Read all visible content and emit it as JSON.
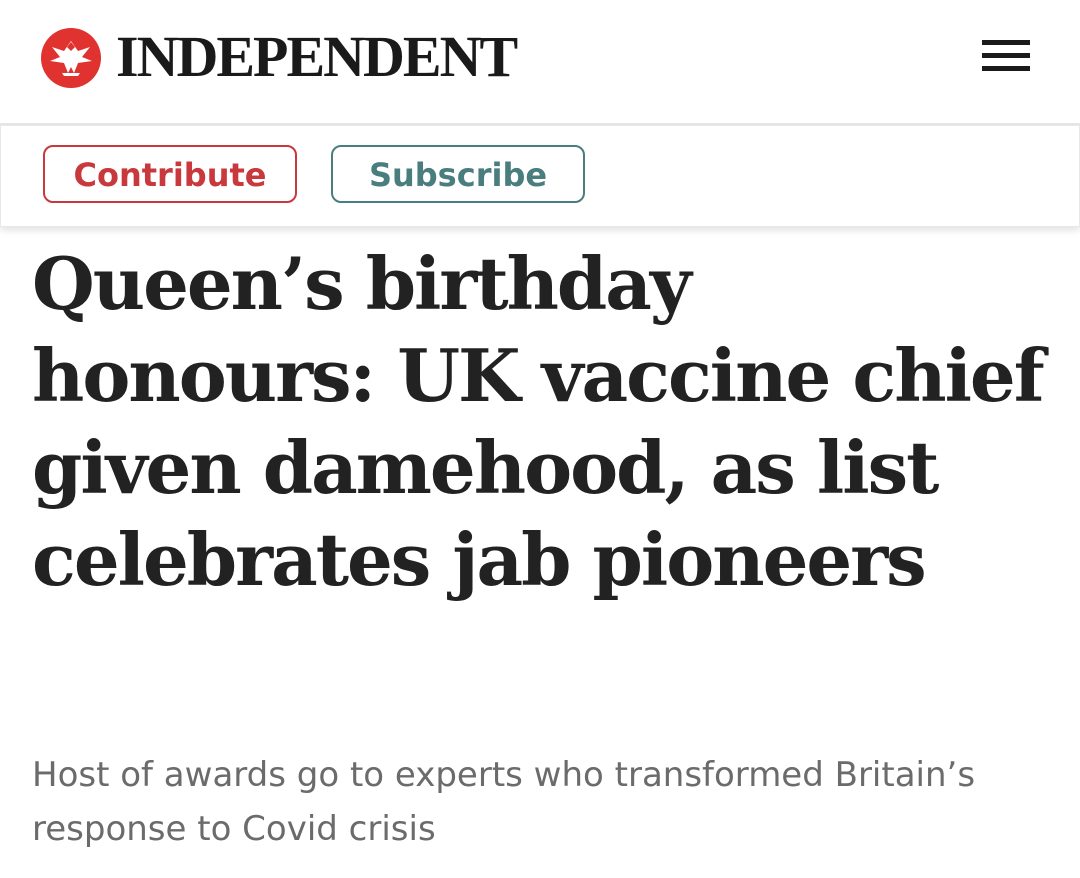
{
  "header": {
    "brand_name": "INDEPENDENT",
    "logo_icon": "eagle-logo-icon",
    "menu_icon": "hamburger-menu-icon"
  },
  "actions": {
    "contribute_label": "Contribute",
    "subscribe_label": "Subscribe"
  },
  "article": {
    "headline": "Queen’s birthday honours: UK vaccine chief given damehood, as list celebrates jab pioneers",
    "standfirst": "Host of awards go to experts who transformed Britain’s response to Covid crisis"
  },
  "colors": {
    "brand_red": "#e0322f",
    "contribute_red": "#c8383c",
    "subscribe_teal": "#4a7d7e",
    "headline_text": "#222222",
    "standfirst_text": "#6b6b6b"
  }
}
